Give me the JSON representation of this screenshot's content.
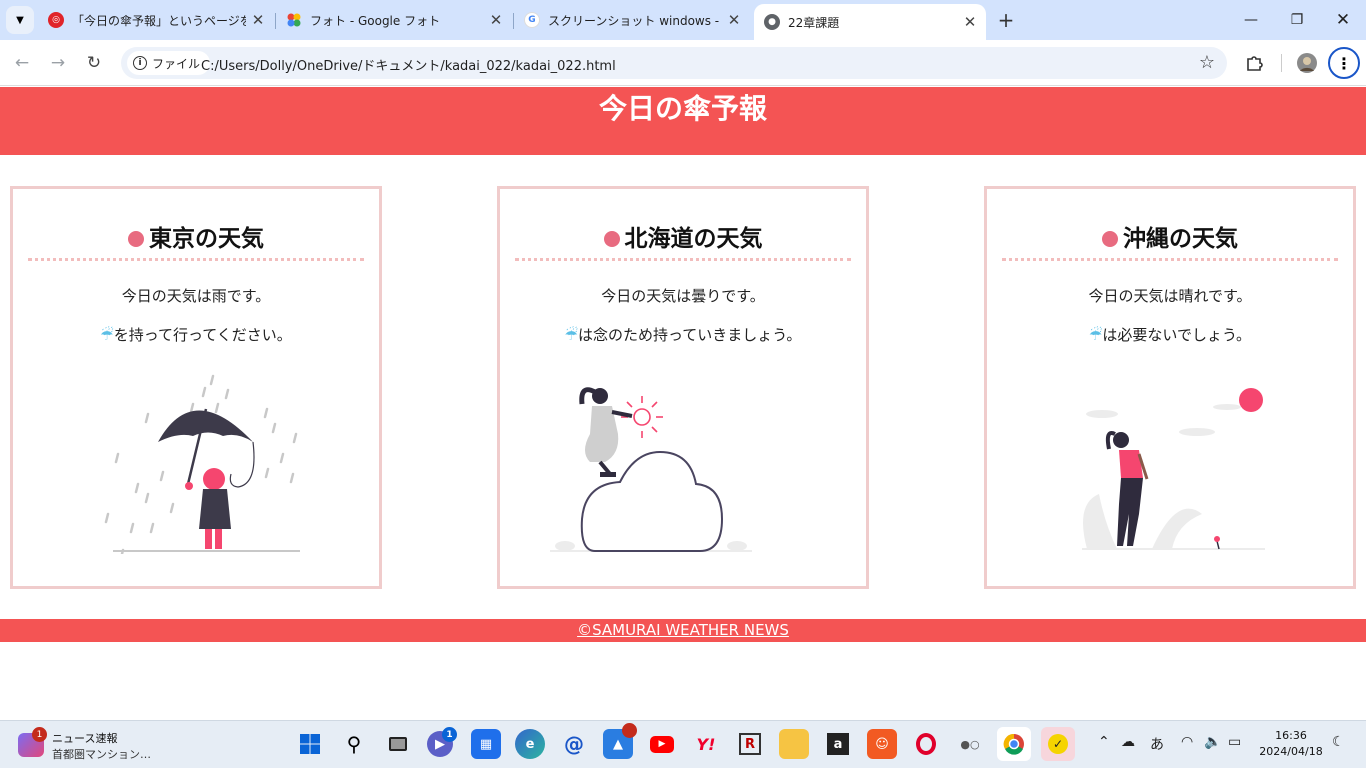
{
  "browser": {
    "tabs": [
      {
        "title": "「今日の傘予報」というページを作成"
      },
      {
        "title": "フォト - Google フォト"
      },
      {
        "title": "スクリーンショット windows - Goog"
      },
      {
        "title": "22章課題"
      }
    ],
    "address": {
      "chip_label": "ファイル",
      "url": "C:/Users/Dolly/OneDrive/ドキュメント/kadai_022/kadai_022.html"
    }
  },
  "page": {
    "header_title": "今日の傘予報",
    "umbrella_glyph": "☔",
    "cards": [
      {
        "title": "東京の天気",
        "line1": "今日の天気は雨です。",
        "line2": "を持って行ってください。"
      },
      {
        "title": "北海道の天気",
        "line1": "今日の天気は曇りです。",
        "line2": "は念のため持っていきましょう。"
      },
      {
        "title": "沖縄の天気",
        "line1": "今日の天気は晴れです。",
        "line2": "は必要ないでしょう。"
      }
    ],
    "footer_link": "©SAMURAI WEATHER NEWS",
    "colors": {
      "header_bg": "#f45454",
      "card_border": "#f0cccc",
      "dot": "#e86b80",
      "umbrella": "#5bbfe6"
    }
  },
  "taskbar": {
    "news_title": "ニュース速報",
    "news_sub": "首都圏マンション…",
    "news_badge": "1",
    "teams_badge": "1",
    "ime": "あ",
    "time": "16:36",
    "date": "2024/04/18",
    "icons": [
      "start-icon",
      "search-icon",
      "task-view-icon",
      "teams-icon",
      "store-icon",
      "edge-icon",
      "mail-icon",
      "photos-icon",
      "youtube-icon",
      "yahoo-icon",
      "rakuten-icon",
      "explorer-icon",
      "amazon-icon",
      "app-icon",
      "opera-icon",
      "app2-icon",
      "chrome-icon",
      "checklist-icon"
    ]
  }
}
